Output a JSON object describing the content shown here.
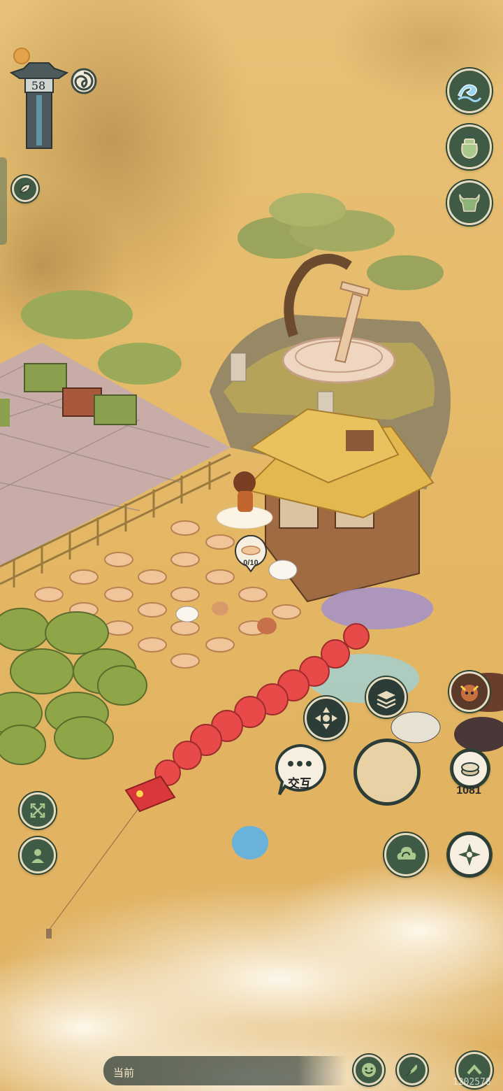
{
  "player": {
    "level": "58"
  },
  "coop": {
    "eggs_count": "0/10"
  },
  "interact": {
    "label": "交互"
  },
  "currency": {
    "amount": "1081"
  },
  "bottom_bar": {
    "current_label": "当前"
  },
  "footer": {
    "id_text": "1202578"
  },
  "icons": {
    "top_right": [
      "wave-icon",
      "pot-icon",
      "ox-head-icon"
    ],
    "left": [
      "leaf-icon",
      "expand-icon",
      "person-icon"
    ],
    "right": [
      "cloud-swirl-icon",
      "compass-icon",
      "coins-icon"
    ],
    "bottom": [
      "smile-icon",
      "quill-icon",
      "chevron-up-icon"
    ]
  },
  "colors": {
    "button_bg": "#3f5b46",
    "button_border": "#e8dcc0",
    "sky": "#e2b664"
  }
}
